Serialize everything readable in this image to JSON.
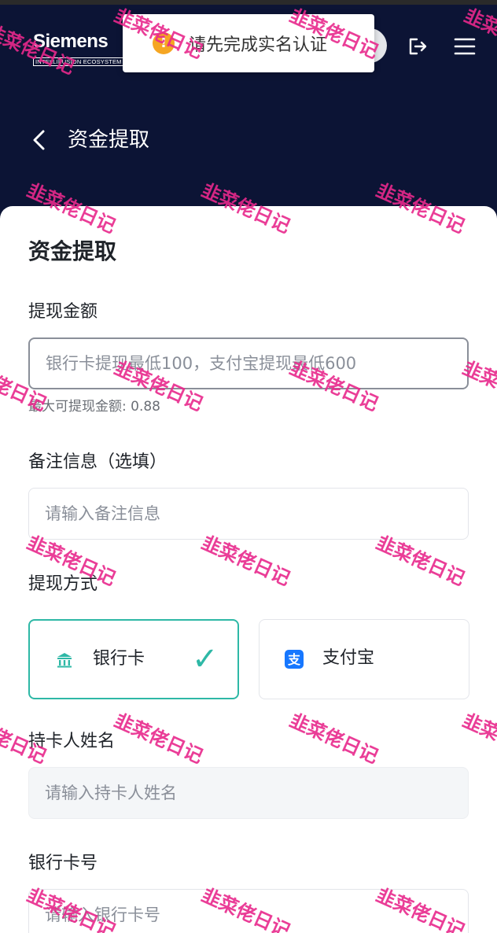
{
  "header": {
    "logo_word": "Siemens",
    "logo_sub": "INTELLIFUSION ECOSYSTEM",
    "nav_title": "资金提取"
  },
  "toast": {
    "message": "请先完成实名认证"
  },
  "form": {
    "title": "资金提取",
    "amount": {
      "label": "提现金额",
      "placeholder": "银行卡提现最低100，支付宝提现最低600",
      "hint": "最大可提现金额: 0.88"
    },
    "note": {
      "label": "备注信息（选填）",
      "placeholder": "请输入备注信息"
    },
    "method": {
      "label": "提现方式",
      "options": [
        {
          "label": "银行卡",
          "icon": "bank-icon",
          "selected": true
        },
        {
          "label": "支付宝",
          "icon": "alipay-icon",
          "selected": false
        }
      ]
    },
    "cardholder": {
      "label": "持卡人姓名",
      "placeholder": "请输入持卡人姓名"
    },
    "card_number": {
      "label": "银行卡号",
      "placeholder": "请输入银行卡号"
    }
  },
  "watermark": "韭菜佬日记",
  "colors": {
    "header_bg": "#0c1435",
    "accent": "#2eb8a6",
    "warning": "#f5a623",
    "alipay": "#1677ff",
    "watermark": "#e8288c"
  }
}
